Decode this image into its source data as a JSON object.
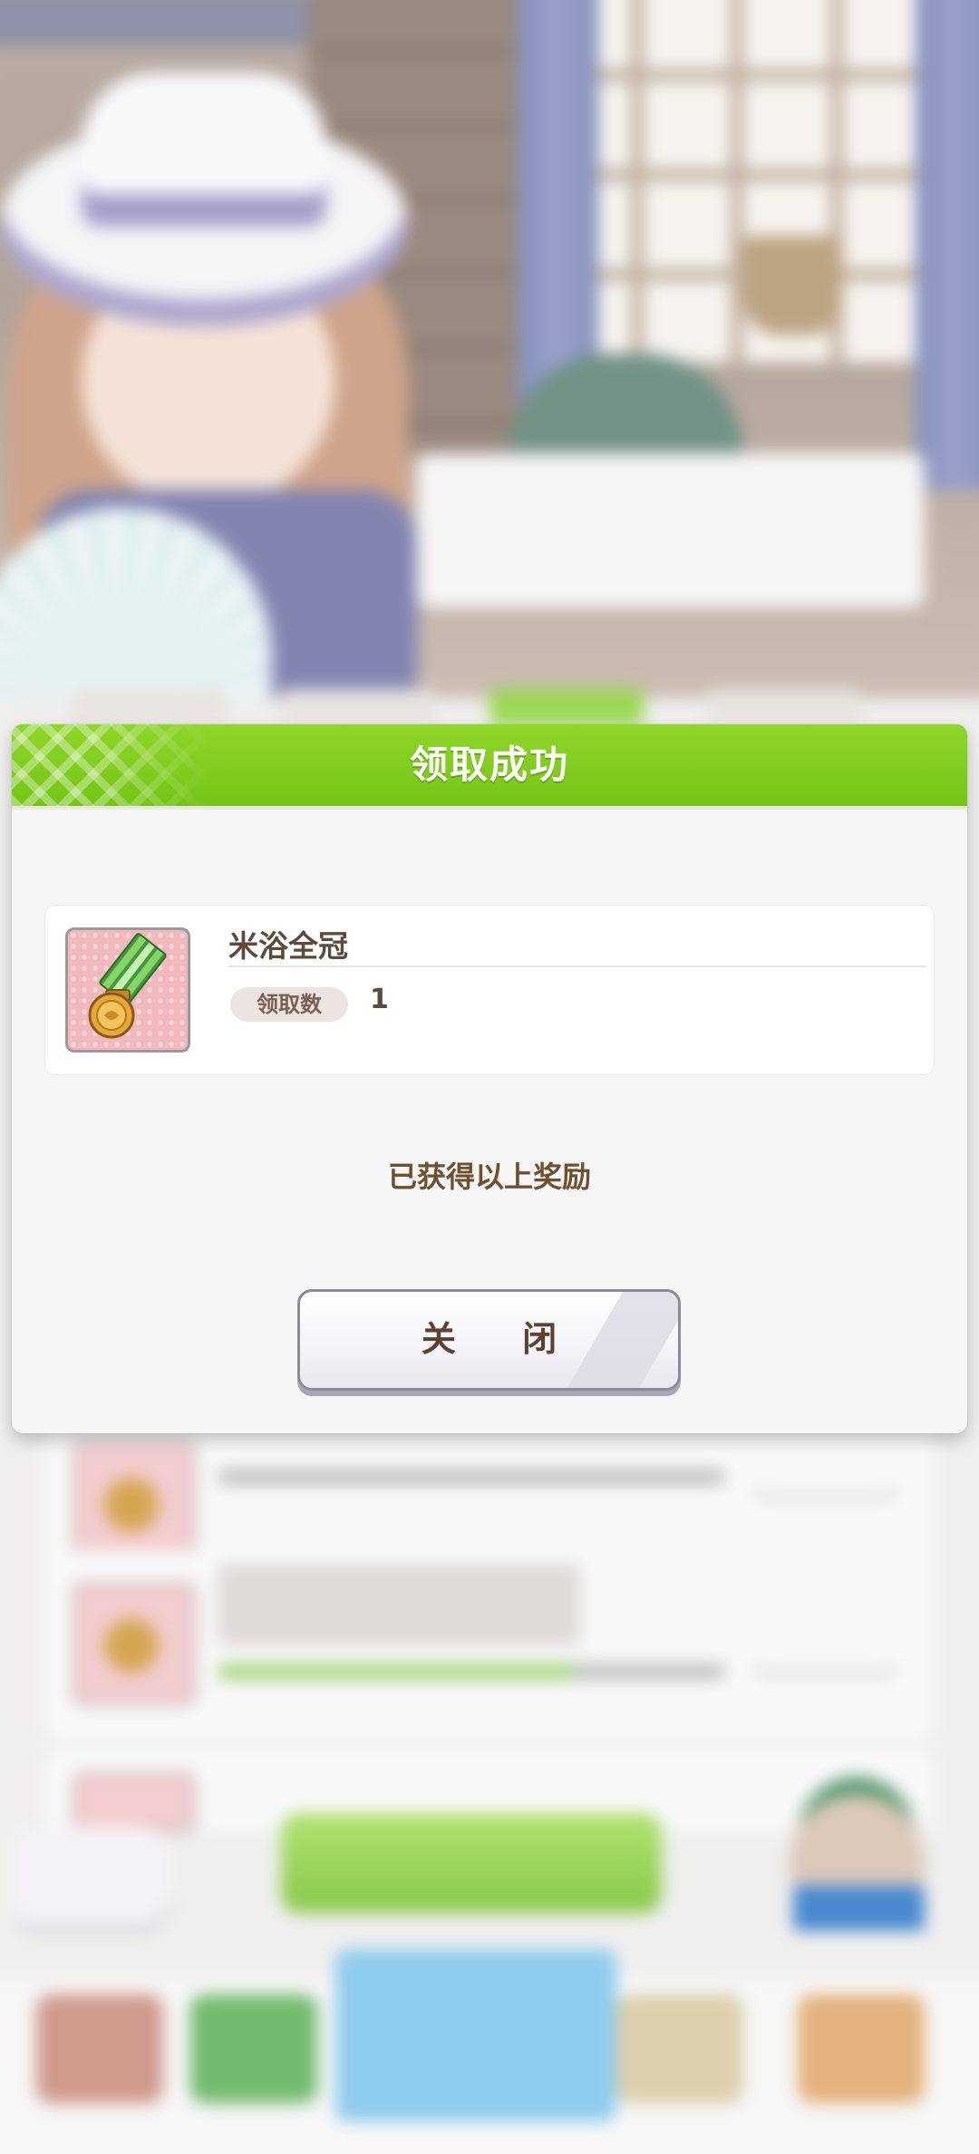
{
  "dialog": {
    "title": "领取成功",
    "item": {
      "name": "米浴全冠",
      "quantity_label": "领取数",
      "quantity": "1",
      "icon": "medal-icon"
    },
    "message": "已获得以上奖励",
    "close_label": "关 闭"
  },
  "colors": {
    "header_green": "#7ccb1c",
    "text_brown": "#5c4a3f",
    "message_brown": "#6e4f2f"
  }
}
